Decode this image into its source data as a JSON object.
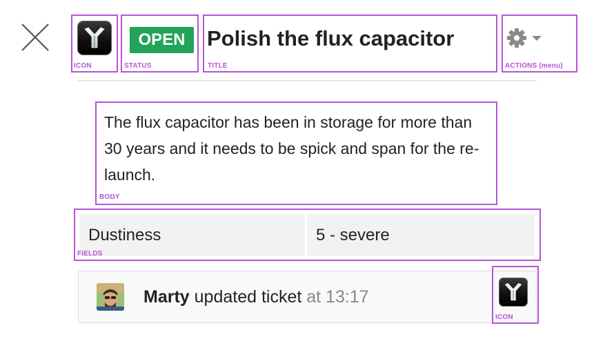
{
  "header": {
    "close_icon": "close-icon",
    "app_icon": "flux-capacitor-icon",
    "status": "OPEN",
    "status_color": "#22a35a",
    "title": "Polish the flux capacitor",
    "actions_icon": "gear-icon",
    "actions_dropdown_icon": "caret-down-icon"
  },
  "body": {
    "text": "The flux capacitor has been in storage for more than 30 years and it needs to be spick and span for the re-launch."
  },
  "fields": [
    {
      "name": "Dustiness",
      "value": "5 - severe"
    }
  ],
  "activity": {
    "avatar_icon": "user-avatar",
    "actor": "Marty",
    "action": "updated ticket",
    "at_label": "at 13:17",
    "app_icon": "flux-capacitor-icon"
  },
  "annotations": {
    "icon": "ICON",
    "status": "STATUS",
    "title": "TITLE",
    "actions": "ACTIONS (menu)",
    "body": "BODY",
    "fields": "FIELDS",
    "icon2": "ICON"
  },
  "colors": {
    "annotation": "#b554d6",
    "status_green": "#22a35a"
  }
}
